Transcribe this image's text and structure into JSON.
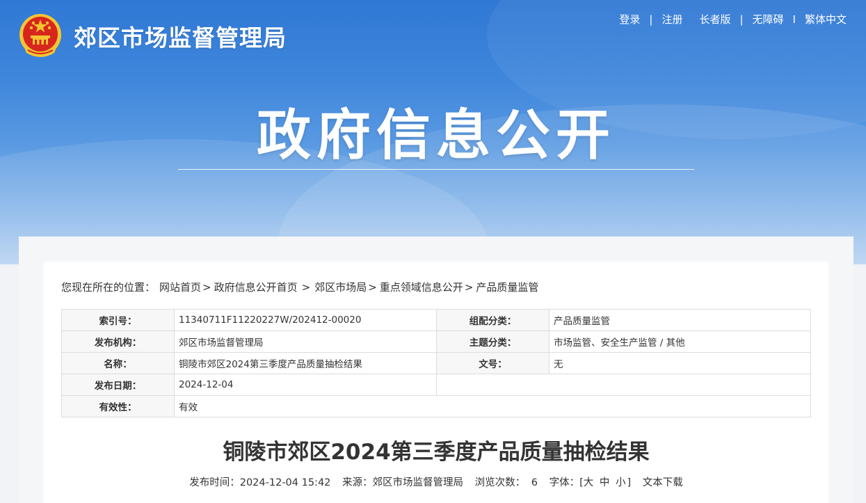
{
  "header": {
    "site_name": "郊区市场监督管理局",
    "links": {
      "login": "登录",
      "register": "注册",
      "elderly": "长者版",
      "accessible": "无障碍",
      "traditional": "繁体中文"
    },
    "separators": {
      "s1": "|",
      "s2": "|",
      "s3": "I"
    }
  },
  "hero": {
    "title": "政府信息公开"
  },
  "breadcrumb": {
    "prefix": "您现在所在的位置：",
    "items": [
      "网站首页",
      "政府信息公开首页",
      "郊区市场局",
      "重点领域信息公开",
      "产品质量监管"
    ],
    "arrows": [
      ">",
      ">",
      ">",
      ">"
    ]
  },
  "meta": {
    "index_label": "索引号：",
    "index_value": "11340711F11220227W/202412-00020",
    "category_label": "组配分类：",
    "category_value": "产品质量监管",
    "publisher_label": "发布机构：",
    "publisher_value": "郊区市场监督管理局",
    "topic_label": "主题分类：",
    "topic_value": "市场监管、安全生产监管 / 其他",
    "name_label": "名称：",
    "name_value": "铜陵市郊区2024第三季度产品质量抽检结果",
    "docno_label": "文号：",
    "docno_value": "无",
    "date_label": "发布日期：",
    "date_value": "2024-12-04",
    "validity_label": "有效性：",
    "validity_value": "有效"
  },
  "article": {
    "title": "铜陵市郊区2024第三季度产品质量抽检结果",
    "publish_time": "发布时间：2024-12-04 15:42",
    "source": "来源：郊区市场监督管理局",
    "views_label": "浏览次数：",
    "views": "6",
    "font_label": "字体：[",
    "font_large": "大",
    "font_mid": "中",
    "font_small": "小",
    "font_close": "]",
    "download": "文本下载"
  },
  "colors": {
    "banner_top": "#2f78d4",
    "banner_bottom": "#b9d3f1",
    "emblem_red": "#d7261e",
    "emblem_gold": "#f4c532"
  }
}
